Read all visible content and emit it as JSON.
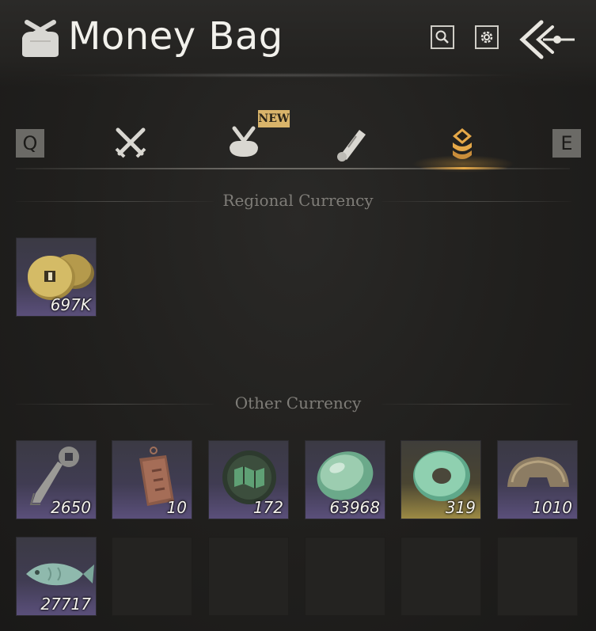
{
  "header": {
    "title": "Money Bag",
    "bag_icon": "money-bag-icon",
    "search_icon": "search-icon",
    "settings_icon": "gear-icon",
    "back_icon": "back-arrow-icon"
  },
  "tabs": {
    "prev_key": "Q",
    "next_key": "E",
    "items": [
      {
        "name": "weapons",
        "icon": "crossed-swords-icon"
      },
      {
        "name": "bag",
        "icon": "cloth-bag-icon",
        "badge": "NEW"
      },
      {
        "name": "scrolls",
        "icon": "scroll-icon"
      },
      {
        "name": "currency",
        "icon": "coin-stack-icon",
        "active": true
      }
    ],
    "accent_color": "#e5a848"
  },
  "sections": {
    "regional": {
      "title": "Regional Currency",
      "items": [
        {
          "name": "coins",
          "icon": "gold-coins-icon",
          "quantity": "697K"
        }
      ]
    },
    "other": {
      "title": "Other Currency",
      "items": [
        {
          "name": "coin-key",
          "icon": "coin-key-icon",
          "quantity": "2650"
        },
        {
          "name": "bronze-tablet",
          "icon": "bronze-tablet-icon",
          "quantity": "10"
        },
        {
          "name": "map-token",
          "icon": "map-token-icon",
          "quantity": "172"
        },
        {
          "name": "jade-stone",
          "icon": "jade-stone-icon",
          "quantity": "63968"
        },
        {
          "name": "jade-ring",
          "icon": "jade-ring-icon",
          "quantity": "319",
          "rarity": "gold"
        },
        {
          "name": "bronze-half-coin",
          "icon": "bronze-half-coin-icon",
          "quantity": "1010"
        },
        {
          "name": "jade-fish",
          "icon": "jade-fish-icon",
          "quantity": "27717"
        }
      ]
    }
  }
}
